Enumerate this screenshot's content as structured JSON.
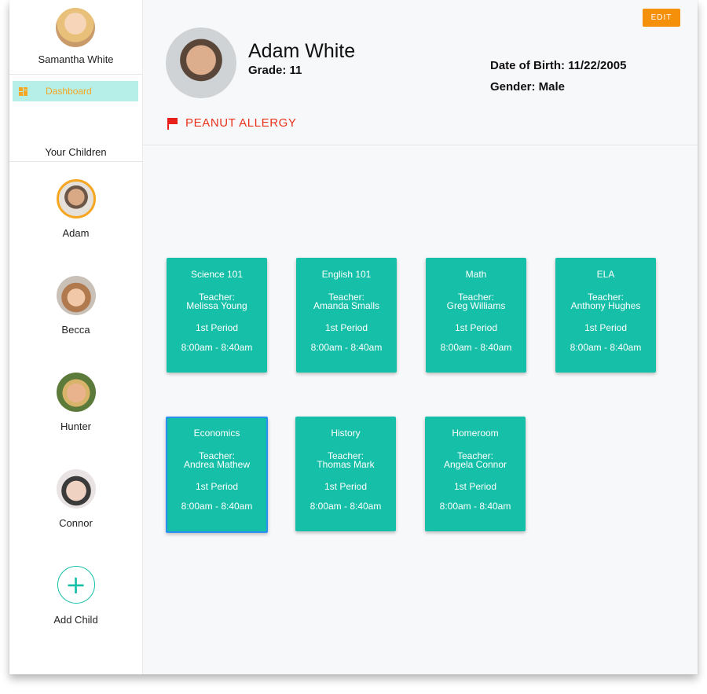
{
  "sidebar": {
    "user_name": "Samantha White",
    "nav": [
      {
        "label": "Dashboard",
        "icon": "dashboard-icon",
        "active": true
      }
    ],
    "children_title": "Your Children",
    "children": [
      {
        "name": "Adam",
        "selected": true
      },
      {
        "name": "Becca"
      },
      {
        "name": "Hunter"
      },
      {
        "name": "Connor"
      }
    ],
    "add_child_label": "Add Child",
    "add_icon_glyph": "+"
  },
  "header": {
    "edit_label": "EDIT",
    "student_name": "Adam White",
    "grade": "Grade: 11",
    "dob": "Date of Birth: 11/22/2005",
    "gender": "Gender: Male",
    "allergy": "PEANUT ALLERGY"
  },
  "classes": [
    {
      "title": "Science 101",
      "teacher_label": "Teacher:",
      "teacher": "Melissa Young",
      "period": "1st Period",
      "time": "8:00am - 8:40am"
    },
    {
      "title": "English 101",
      "teacher_label": "Teacher:",
      "teacher": "Amanda Smalls",
      "period": "1st Period",
      "time": "8:00am - 8:40am"
    },
    {
      "title": "Math",
      "teacher_label": "Teacher:",
      "teacher": "Greg Williams",
      "period": "1st Period",
      "time": "8:00am - 8:40am"
    },
    {
      "title": "ELA",
      "teacher_label": "Teacher:",
      "teacher": "Anthony Hughes",
      "period": "1st Period",
      "time": "8:00am - 8:40am"
    },
    {
      "title": "Economics",
      "teacher_label": "Teacher:",
      "teacher": "Andrea Mathew",
      "period": "1st Period",
      "time": "8:00am - 8:40am",
      "selected": true
    },
    {
      "title": "History",
      "teacher_label": "Teacher:",
      "teacher": "Thomas Mark",
      "period": "1st Period",
      "time": "8:00am - 8:40am"
    },
    {
      "title": "Homeroom",
      "teacher_label": "Teacher:",
      "teacher": "Angela Connor",
      "period": "1st Period",
      "time": "8:00am - 8:40am"
    }
  ],
  "colors": {
    "accent": "#16bfa7",
    "orange": "#f5900a",
    "alert": "#e8321c",
    "selected_border": "#2a8ff0",
    "nav_active_bg": "#b5efe8"
  }
}
